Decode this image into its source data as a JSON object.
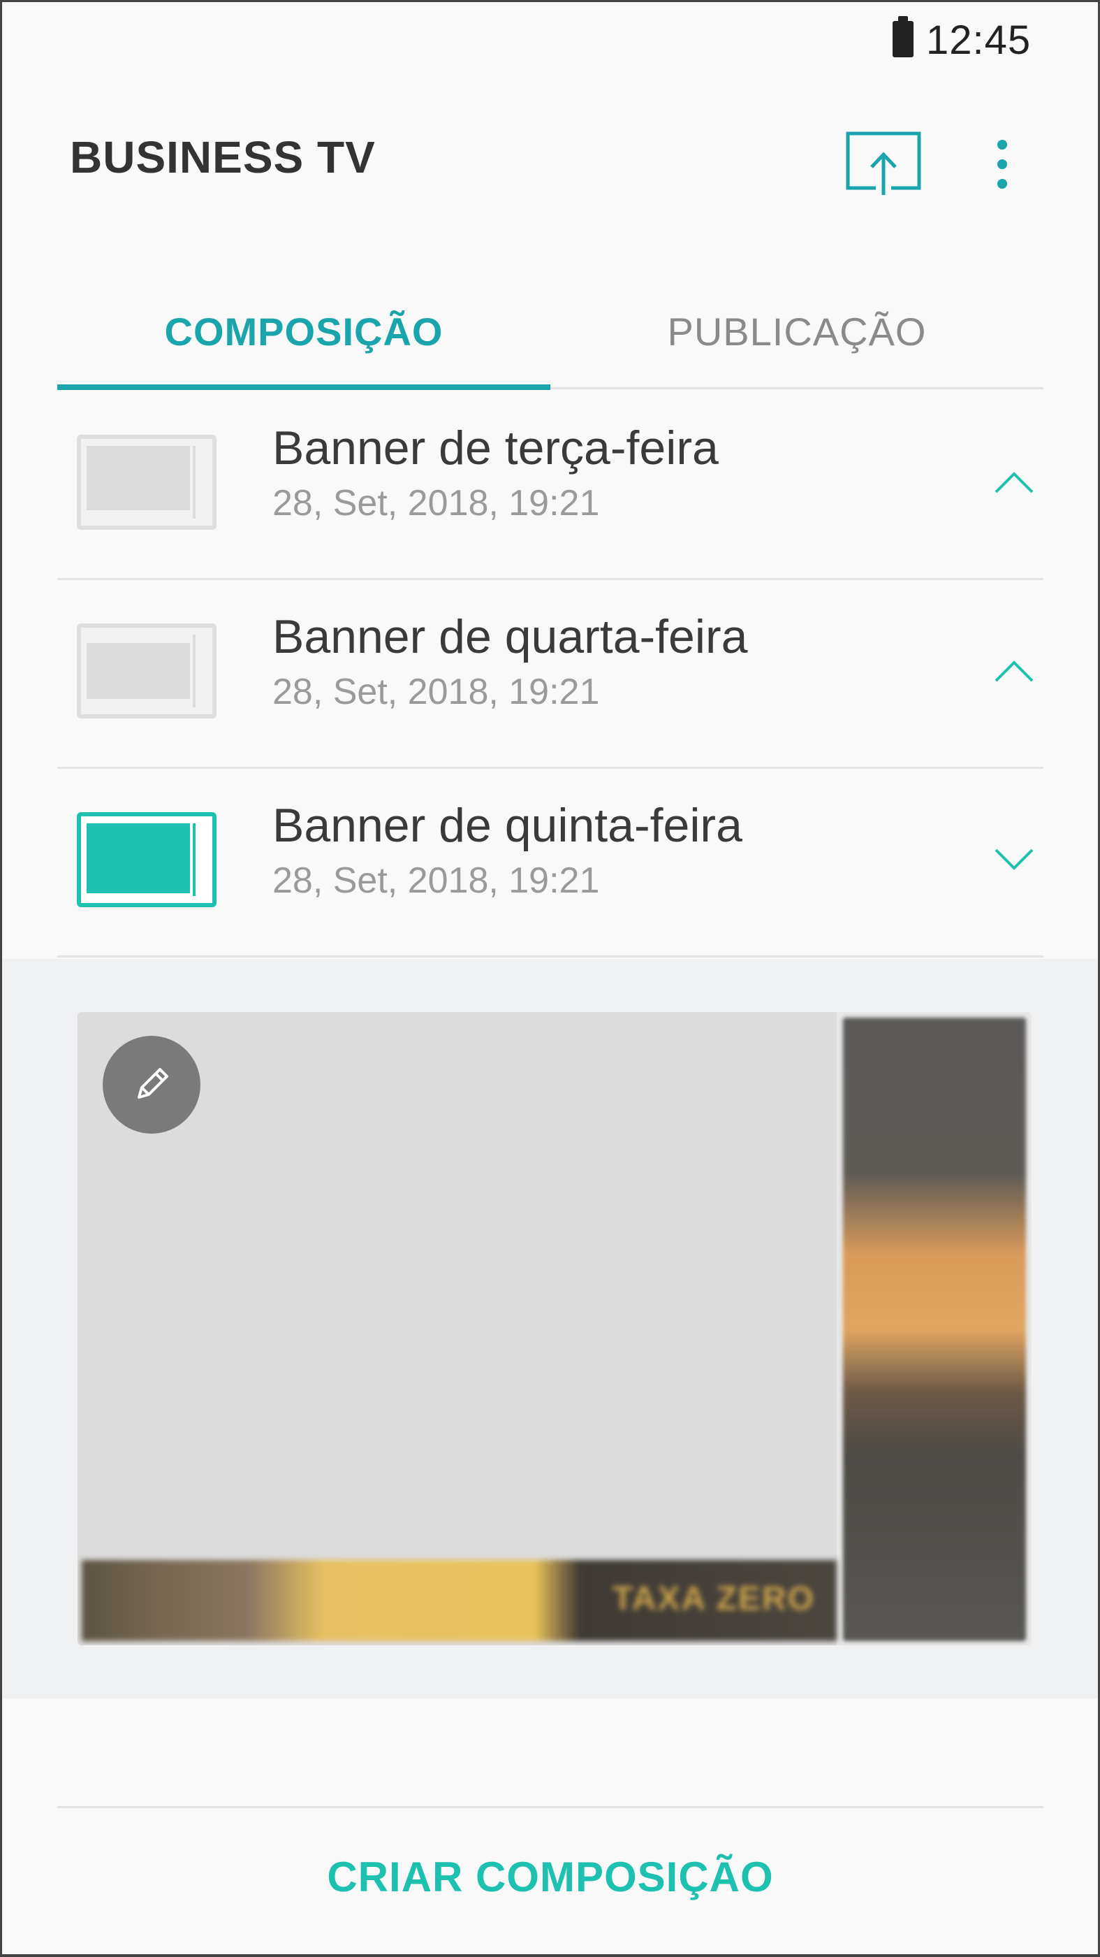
{
  "status_bar": {
    "time": "12:45",
    "battery_icon": "battery-full-icon"
  },
  "app_bar": {
    "title": "BUSINESS TV",
    "cast_icon": "screen-share-icon",
    "more_icon": "more-vertical-icon"
  },
  "tabs": [
    {
      "label": "COMPOSIÇÃO",
      "selected": true
    },
    {
      "label": "PUBLICAÇÃO",
      "selected": false
    }
  ],
  "compositions": [
    {
      "title": "Banner de terça-feira",
      "date": "28, Set, 2018, 19:21",
      "expanded": false,
      "chevron": "chevron-up-icon"
    },
    {
      "title": "Banner de quarta-feira",
      "date": "28, Set, 2018, 19:21",
      "expanded": false,
      "chevron": "chevron-up-icon"
    },
    {
      "title": "Banner de quinta-feira",
      "date": "28, Set, 2018, 19:21",
      "expanded": true,
      "chevron": "chevron-down-icon"
    }
  ],
  "preview": {
    "edit_icon": "pencil-icon",
    "banner_text": "TAXA ZERO"
  },
  "footer": {
    "create_label": "CRIAR COMPOSIÇÃO"
  },
  "colors": {
    "accent": "#1aa5ad",
    "accent_active": "#1ec1b0",
    "background": "#f9f9f9"
  }
}
